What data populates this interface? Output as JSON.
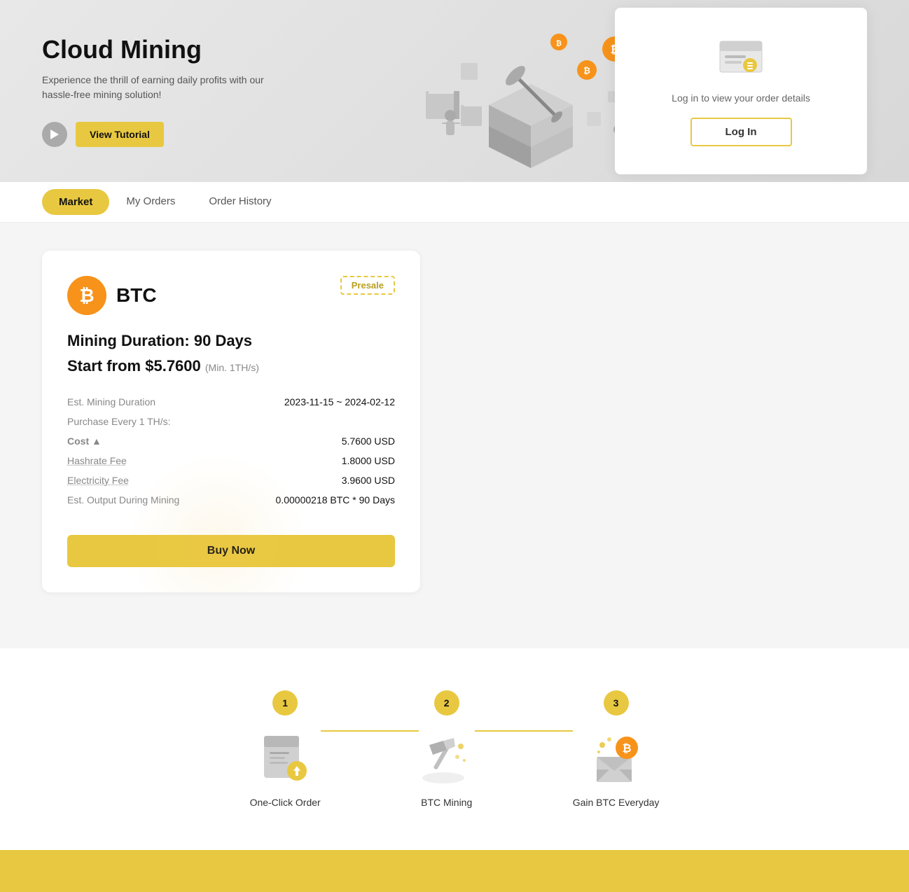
{
  "hero": {
    "title": "Cloud Mining",
    "subtitle": "Experience the thrill of earning daily profits with our hassle-free mining solution!",
    "tutorial_label": "View Tutorial",
    "login_card": {
      "text": "Log in to view your order details",
      "login_label": "Log In"
    }
  },
  "tabs": [
    {
      "id": "market",
      "label": "Market",
      "active": true
    },
    {
      "id": "my-orders",
      "label": "My Orders",
      "active": false
    },
    {
      "id": "order-history",
      "label": "Order History",
      "active": false
    }
  ],
  "mining_card": {
    "coin": "BTC",
    "coin_symbol": "₿",
    "presale": "Presale",
    "duration_label": "Mining Duration: 90 Days",
    "start_from_label": "Start from $5.7600",
    "min_label": "(Min. 1TH/s)",
    "est_duration_label": "Est. Mining Duration",
    "est_duration_value": "2023-11-15 ~ 2024-02-12",
    "purchase_label": "Purchase Every 1 TH/s:",
    "cost_label": "Cost ▲",
    "cost_value": "5.7600 USD",
    "hashrate_fee_label": "Hashrate Fee",
    "hashrate_fee_value": "1.8000 USD",
    "electricity_fee_label": "Electricity Fee",
    "electricity_fee_value": "3.9600 USD",
    "est_output_label": "Est. Output During Mining",
    "est_output_value": "0.00000218 BTC * 90 Days",
    "buy_label": "Buy Now"
  },
  "steps": [
    {
      "number": "1",
      "label": "One-Click Order"
    },
    {
      "number": "2",
      "label": "BTC Mining"
    },
    {
      "number": "3",
      "label": "Gain BTC Everyday"
    }
  ]
}
